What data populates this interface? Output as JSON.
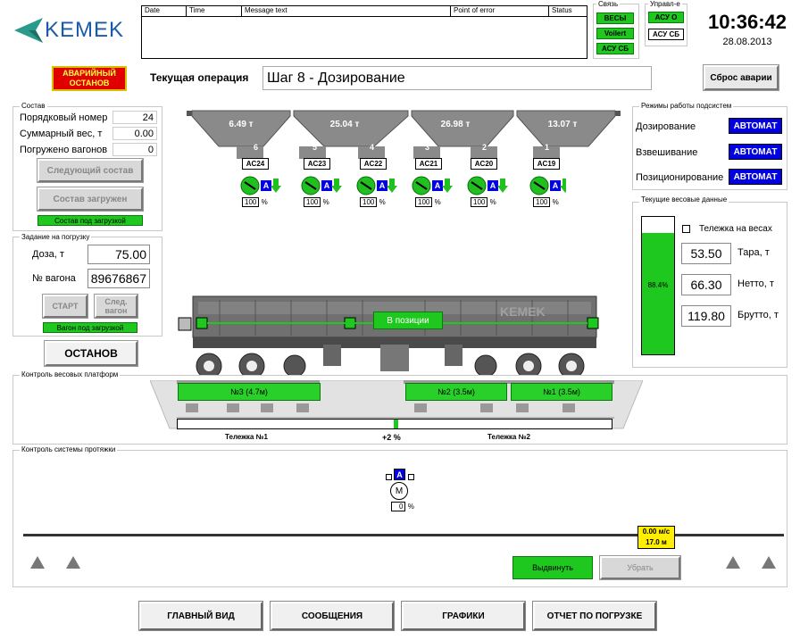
{
  "logo": {
    "text": "KEMEK"
  },
  "messages": {
    "columns": [
      "Date",
      "Time",
      "Message text",
      "Point of error",
      "Status"
    ]
  },
  "comm": {
    "title": "Связь",
    "items": [
      "ВЕСЫ",
      "Voilert",
      "АСУ СБ"
    ]
  },
  "control": {
    "title": "Управл-е",
    "items": [
      "АСУ О",
      "АСУ СБ"
    ]
  },
  "clock": {
    "time": "10:36:42",
    "date": "28.08.2013"
  },
  "emergency_stop": "АВАРИЙНЫЙ ОСТАНОВ",
  "operation": {
    "label": "Текущая операция",
    "value": "Шаг 8 - Дозирование"
  },
  "reset_alarm": "Сброс аварии",
  "train": {
    "title": "Состав",
    "rows": [
      {
        "label": "Порядковый номер",
        "value": "24"
      },
      {
        "label": "Суммарный вес, т",
        "value": "0.00"
      },
      {
        "label": "Погружено вагонов",
        "value": "0"
      }
    ],
    "next_button": "Следующий состав",
    "loaded_button": "Состав загружен",
    "status": "Состав под загрузкой"
  },
  "task": {
    "title": "Задание на погрузку",
    "dose_label": "Доза, т",
    "dose_value": "75.00",
    "wagon_label": "№ вагона",
    "wagon_value": "89676867",
    "start_button": "СТАРТ",
    "next_wagon_button": "След. вагон",
    "status": "Вагон под загрузкой"
  },
  "stop_button": "ОСТАНОВ",
  "hoppers": [
    {
      "weight": "6.49 т",
      "nums": [
        "6"
      ]
    },
    {
      "weight": "25.04 т",
      "nums": [
        "5",
        "4"
      ]
    },
    {
      "weight": "26.98 т",
      "nums": [
        "3",
        "2"
      ]
    },
    {
      "weight": "13.07 т",
      "nums": [
        "1"
      ]
    }
  ],
  "feeders": [
    {
      "id": "AC24",
      "pct": "100"
    },
    {
      "id": "AC23",
      "pct": "100"
    },
    {
      "id": "AC22",
      "pct": "100"
    },
    {
      "id": "AC21",
      "pct": "100"
    },
    {
      "id": "AC20",
      "pct": "100"
    },
    {
      "id": "AC19",
      "pct": "100"
    }
  ],
  "feeder_mode": "A",
  "percent_sign": "%",
  "modes": {
    "title": "Режимы работы подсистем",
    "items": [
      {
        "label": "Дозирование",
        "value": "АВТОМАТ"
      },
      {
        "label": "Взвешивание",
        "value": "АВТОМАТ"
      },
      {
        "label": "Позиционирование",
        "value": "АВТОМАТ"
      }
    ]
  },
  "weights": {
    "title": "Текущие весовые данные",
    "fill_percent": 88.4,
    "fill_label": "88.4%",
    "cart_label": "Тележка на весах",
    "rows": [
      {
        "value": "53.50",
        "label": "Тара, т"
      },
      {
        "value": "66.30",
        "label": "Нетто, т"
      },
      {
        "value": "119.80",
        "label": "Брутто, т"
      }
    ]
  },
  "wagon": {
    "position_label": "В позиции",
    "brand": "KEMEK"
  },
  "platforms": {
    "title": "Контроль весовых платформ",
    "items": [
      "№3 (4.7м)",
      "№2 (3.5м)",
      "№1 (3.5м)"
    ],
    "offset": "+2 %",
    "cart1": "Тележка №1",
    "cart2": "Тележка №2"
  },
  "pulling": {
    "title": "Контроль системы протяжки",
    "motor_mode": "A",
    "motor_label": "M",
    "motor_pct": "0",
    "speed": "0.00 м/с",
    "distance": "17.0 м",
    "extend_button": "Выдвинуть",
    "retract_button": "Убрать"
  },
  "nav": [
    "ГЛАВНЫЙ ВИД",
    "СООБЩЕНИЯ",
    "ГРАФИКИ",
    "ОТЧЕТ ПО ПОГРУЗКЕ"
  ]
}
